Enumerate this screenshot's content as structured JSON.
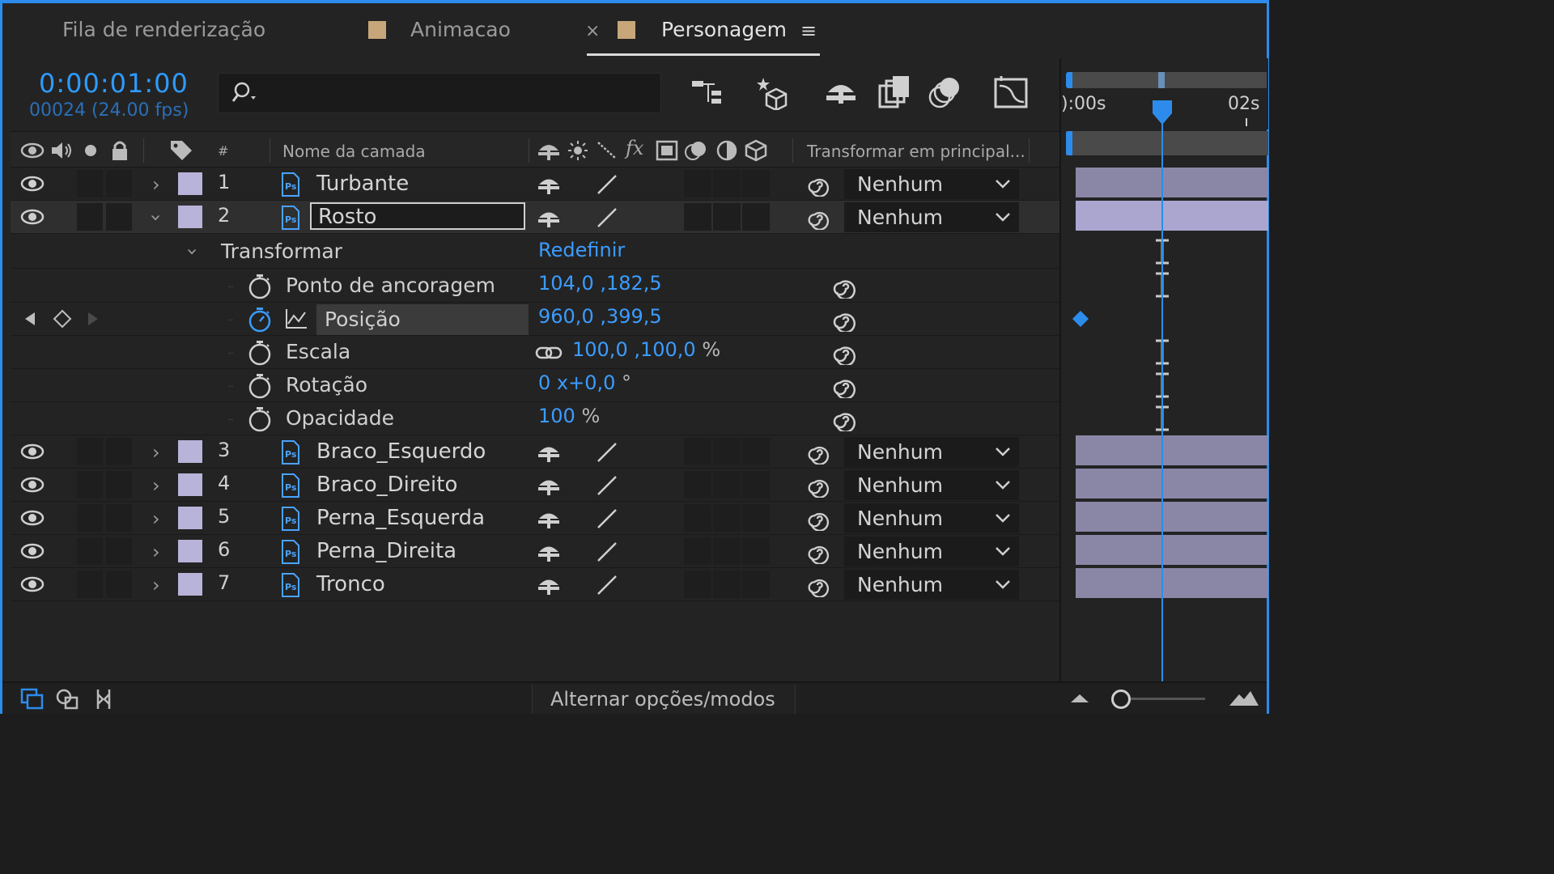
{
  "tabs": {
    "render_queue": "Fila de renderização",
    "animacao": "Animacao",
    "close": "×",
    "personagem": "Personagem",
    "menu": "≡"
  },
  "header": {
    "timecode": "0:00:01:00",
    "fps": "00024 (24.00 fps)"
  },
  "columns": {
    "hash": "#",
    "layer_name": "Nome da camada",
    "parent": "Transformar em principal..."
  },
  "layers": [
    {
      "num": "1",
      "name": "Turbante",
      "parent": "Nenhum"
    },
    {
      "num": "2",
      "name": "Rosto",
      "parent": "Nenhum"
    },
    {
      "num": "3",
      "name": "Braco_Esquerdo",
      "parent": "Nenhum"
    },
    {
      "num": "4",
      "name": "Braco_Direito",
      "parent": "Nenhum"
    },
    {
      "num": "5",
      "name": "Perna_Esquerda",
      "parent": "Nenhum"
    },
    {
      "num": "6",
      "name": "Perna_Direita",
      "parent": "Nenhum"
    },
    {
      "num": "7",
      "name": "Tronco",
      "parent": "Nenhum"
    }
  ],
  "transform": {
    "label": "Transformar",
    "reset": "Redefinir",
    "anchor": {
      "label": "Ponto de ancoragem",
      "value": "104,0 ,182,5"
    },
    "position": {
      "label": "Posição",
      "value": "960,0 ,399,5"
    },
    "scale": {
      "label": "Escala",
      "value": "100,0 ,100,0",
      "unit": "%"
    },
    "rotation": {
      "label": "Rotação",
      "value": "0 x+0,0",
      "unit": "°"
    },
    "opacity": {
      "label": "Opacidade",
      "value": "100",
      "unit": "%"
    }
  },
  "timeline": {
    "start": "):00s",
    "end": "02s"
  },
  "footer": {
    "toggle": "Alternar opções/modos"
  },
  "colors": {
    "accent": "#2d8ceb",
    "label": "#b7b3d9",
    "tab_swatch": "#c7a77a"
  }
}
